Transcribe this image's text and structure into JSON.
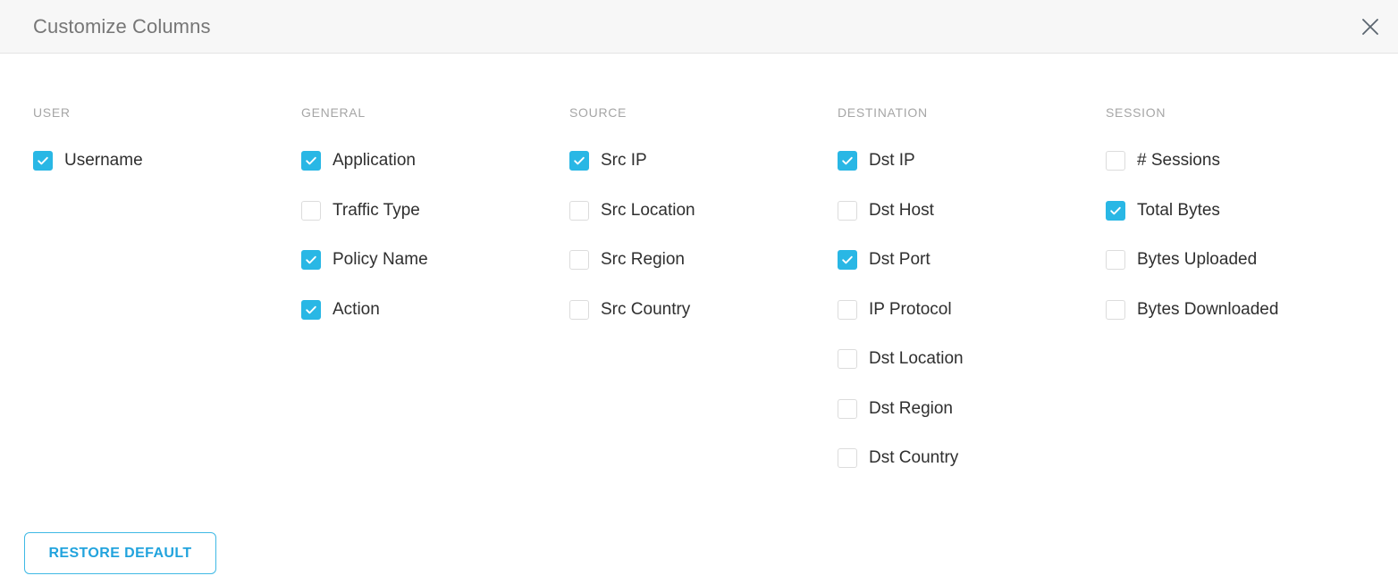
{
  "modal": {
    "title": "Customize Columns",
    "close_icon": "close-icon"
  },
  "colors": {
    "accent": "#29b7e5",
    "button_border": "#3fb9e5",
    "button_text": "#21a3dd",
    "header_bg": "#f7f7f7",
    "heading_text": "#a6a6a6",
    "label_text": "#2f2f2f",
    "checkbox_border": "#dcdcdc"
  },
  "column_groups": [
    {
      "heading": "USER",
      "options": [
        {
          "label": "Username",
          "checked": true
        }
      ]
    },
    {
      "heading": "GENERAL",
      "options": [
        {
          "label": "Application",
          "checked": true
        },
        {
          "label": "Traffic Type",
          "checked": false
        },
        {
          "label": "Policy Name",
          "checked": true
        },
        {
          "label": "Action",
          "checked": true
        }
      ]
    },
    {
      "heading": "SOURCE",
      "options": [
        {
          "label": "Src IP",
          "checked": true
        },
        {
          "label": "Src Location",
          "checked": false
        },
        {
          "label": "Src Region",
          "checked": false
        },
        {
          "label": "Src Country",
          "checked": false
        }
      ]
    },
    {
      "heading": "DESTINATION",
      "options": [
        {
          "label": "Dst IP",
          "checked": true
        },
        {
          "label": "Dst Host",
          "checked": false
        },
        {
          "label": "Dst Port",
          "checked": true
        },
        {
          "label": "IP Protocol",
          "checked": false
        },
        {
          "label": "Dst Location",
          "checked": false
        },
        {
          "label": "Dst Region",
          "checked": false
        },
        {
          "label": "Dst Country",
          "checked": false
        }
      ]
    },
    {
      "heading": "SESSION",
      "options": [
        {
          "label": "# Sessions",
          "checked": false
        },
        {
          "label": "Total Bytes",
          "checked": true
        },
        {
          "label": "Bytes Uploaded",
          "checked": false
        },
        {
          "label": "Bytes Downloaded",
          "checked": false
        }
      ]
    }
  ],
  "footer": {
    "restore_default_label": "RESTORE DEFAULT"
  }
}
